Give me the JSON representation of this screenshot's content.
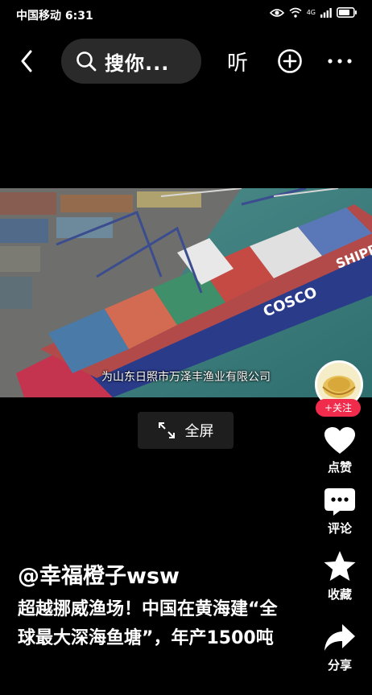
{
  "status_bar": {
    "carrier": "中国移动",
    "time": "6:31",
    "network": "4G"
  },
  "top_nav": {
    "search_text": "搜你...",
    "listen_label": "听"
  },
  "video": {
    "caption": "为山东日照市万泽丰渔业有限公司",
    "fullscreen_label": "全屏"
  },
  "rail": {
    "follow_label": "+关注",
    "like_label": "点赞",
    "comment_label": "评论",
    "favorite_label": "收藏",
    "share_label": "分享"
  },
  "post": {
    "author": "@幸福橙子wsw",
    "description": "超越挪威渔场！中国在黄海建“全球最大深海鱼塘”，年产1500吨"
  },
  "colors": {
    "follow": "#f02b4b",
    "search_bg": "#2a2a2a",
    "background": "#000000"
  }
}
